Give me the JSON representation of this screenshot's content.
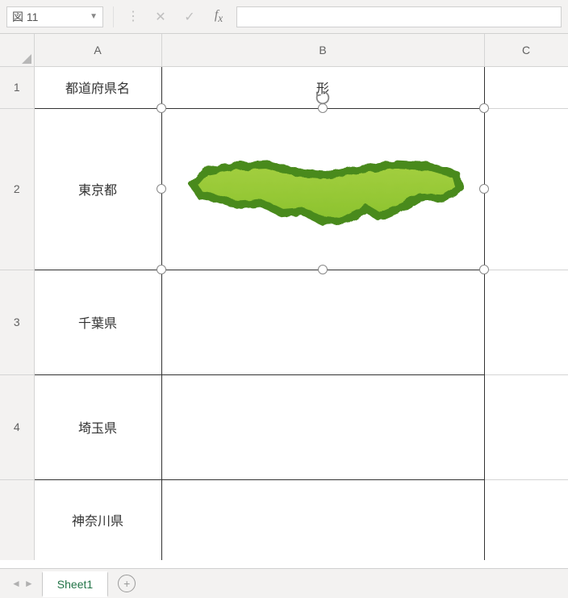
{
  "name_box": {
    "value": "図 11"
  },
  "formula": {
    "value": ""
  },
  "columns": {
    "A": "A",
    "B": "B",
    "C": "C"
  },
  "row_headers": {
    "r1": "1",
    "r2": "2",
    "r3": "3",
    "r4": "4"
  },
  "cells": {
    "header_A": "都道府県名",
    "header_B": "形",
    "row2_A": "東京都",
    "row3_A": "千葉県",
    "row4_A": "埼玉県",
    "row5_A": "神奈川県"
  },
  "sheet_tab": {
    "active": "Sheet1"
  }
}
